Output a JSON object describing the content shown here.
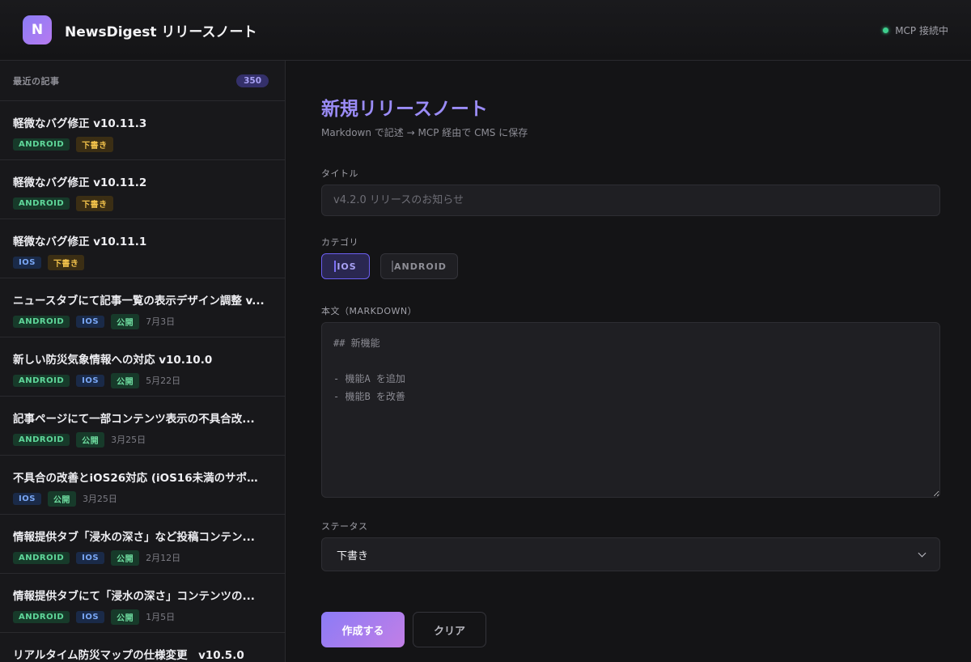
{
  "header": {
    "logo_letter": "N",
    "title": "NewsDigest リリースノート",
    "status": "MCP 接続中",
    "status_color": "#3ecf8e"
  },
  "sidebar": {
    "heading": "最近の記事",
    "count": "350",
    "articles": [
      {
        "title": "軽微なバグ修正 v10.11.3",
        "tags": [
          {
            "label": "ANDROID",
            "type": "android"
          },
          {
            "label": "下書き",
            "type": "draft"
          }
        ],
        "date": ""
      },
      {
        "title": "軽微なバグ修正 v10.11.2",
        "tags": [
          {
            "label": "ANDROID",
            "type": "android"
          },
          {
            "label": "下書き",
            "type": "draft"
          }
        ],
        "date": ""
      },
      {
        "title": "軽微なバグ修正 v10.11.1",
        "tags": [
          {
            "label": "IOS",
            "type": "ios"
          },
          {
            "label": "下書き",
            "type": "draft"
          }
        ],
        "date": ""
      },
      {
        "title": "ニュースタブにて記事一覧の表示デザイン調整 v...",
        "tags": [
          {
            "label": "ANDROID",
            "type": "android"
          },
          {
            "label": "IOS",
            "type": "ios"
          },
          {
            "label": "公開",
            "type": "published"
          }
        ],
        "date": "7月3日"
      },
      {
        "title": "新しい防災気象情報への対応 v10.10.0",
        "tags": [
          {
            "label": "ANDROID",
            "type": "android"
          },
          {
            "label": "IOS",
            "type": "ios"
          },
          {
            "label": "公開",
            "type": "published"
          }
        ],
        "date": "5月22日"
      },
      {
        "title": "記事ページにて一部コンテンツ表示の不具合改...",
        "tags": [
          {
            "label": "ANDROID",
            "type": "android"
          },
          {
            "label": "公開",
            "type": "published"
          }
        ],
        "date": "3月25日"
      },
      {
        "title": "不具合の改善とiOS26対応 (iOS16未満のサポー...",
        "tags": [
          {
            "label": "IOS",
            "type": "ios"
          },
          {
            "label": "公開",
            "type": "published"
          }
        ],
        "date": "3月25日"
      },
      {
        "title": "情報提供タブ「浸水の深さ」など投稿コンテン...",
        "tags": [
          {
            "label": "ANDROID",
            "type": "android"
          },
          {
            "label": "IOS",
            "type": "ios"
          },
          {
            "label": "公開",
            "type": "published"
          }
        ],
        "date": "2月12日"
      },
      {
        "title": "情報提供タブにて「浸水の深さ」コンテンツの...",
        "tags": [
          {
            "label": "ANDROID",
            "type": "android"
          },
          {
            "label": "IOS",
            "type": "ios"
          },
          {
            "label": "公開",
            "type": "published"
          }
        ],
        "date": "1月5日"
      },
      {
        "title": "リアルタイム防災マップの仕様変更　v10.5.0",
        "tags": [],
        "date": ""
      }
    ]
  },
  "form": {
    "title": "新規リリースノート",
    "subtitle": "Markdown で記述 → MCP 経由で CMS に保存",
    "title_label": "タイトル",
    "title_placeholder": "v4.2.0 リリースのお知らせ",
    "category_label": "カテゴリ",
    "category_ios": "IOS",
    "category_android": "ANDROID",
    "body_label": "本文（MARKDOWN）",
    "body_placeholder": "## 新機能\n\n- 機能A を追加\n- 機能B を改善",
    "status_label": "ステータス",
    "status_value": "下書き",
    "submit_label": "作成する",
    "clear_label": "クリア"
  }
}
